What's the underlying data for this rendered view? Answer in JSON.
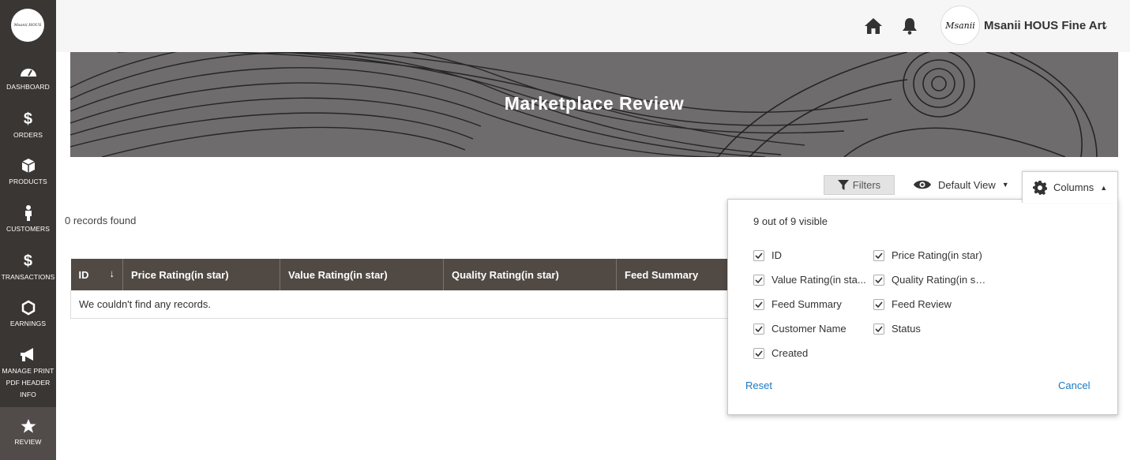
{
  "sidebar": {
    "logo_text": "Msanii HOUS",
    "items": [
      {
        "label": "DASHBOARD",
        "icon": "dashboard-icon"
      },
      {
        "label": "ORDERS",
        "icon": "dollar-icon"
      },
      {
        "label": "PRODUCTS",
        "icon": "box-icon"
      },
      {
        "label": "CUSTOMERS",
        "icon": "person-icon"
      },
      {
        "label": "TRANSACTIONS",
        "icon": "dollar-icon"
      },
      {
        "label": "EARNINGS",
        "icon": "hexagon-icon"
      },
      {
        "label": "MANAGE PRINT",
        "label2": "PDF HEADER",
        "label3": "INFO",
        "icon": "megaphone-icon"
      },
      {
        "label": "REVIEW",
        "icon": "star-icon",
        "active": true
      }
    ]
  },
  "header": {
    "store_name": "Msanii HOUS Fine Art",
    "avatar_text": "Msanii"
  },
  "banner": {
    "title": "Marketplace Review"
  },
  "toolbar": {
    "filters_label": "Filters",
    "view_label": "Default View",
    "columns_label": "Columns"
  },
  "records_text": "0 records found",
  "grid": {
    "headers": [
      "ID",
      "Price Rating(in star)",
      "Value Rating(in star)",
      "Quality Rating(in star)",
      "Feed Summary"
    ],
    "empty_text": "We couldn't find any records."
  },
  "columns_panel": {
    "count_text": "9 out of 9 visible",
    "options": [
      {
        "label": "ID",
        "checked": true
      },
      {
        "label": "Price Rating(in star)",
        "checked": true
      },
      {
        "label": "Value Rating(in sta...",
        "checked": true
      },
      {
        "label": "Quality Rating(in st...",
        "checked": true
      },
      {
        "label": "Feed Summary",
        "checked": true
      },
      {
        "label": "Feed Review",
        "checked": true
      },
      {
        "label": "Customer Name",
        "checked": true
      },
      {
        "label": "Status",
        "checked": true
      },
      {
        "label": "Created",
        "checked": true
      }
    ],
    "reset_label": "Reset",
    "cancel_label": "Cancel"
  },
  "colors": {
    "sidebar": "#3a3634",
    "table_header": "#514a44",
    "link": "#1979c3"
  }
}
